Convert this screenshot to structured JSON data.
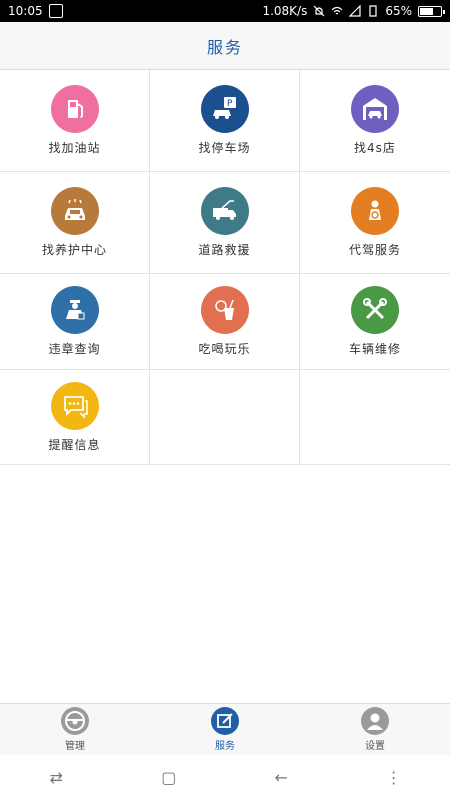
{
  "status": {
    "time": "10:05",
    "speed": "1.08K/s",
    "battery": "65%",
    "battery_level": 0.65
  },
  "header": {
    "title": "服务"
  },
  "services": [
    {
      "label": "找加油站",
      "icon": "gas-station-icon",
      "color": "#ee6fa0"
    },
    {
      "label": "找停车场",
      "icon": "parking-icon",
      "color": "#1c4f8f"
    },
    {
      "label": "找4s店",
      "icon": "car-garage-icon",
      "color": "#6f5fc0"
    },
    {
      "label": "找养护中心",
      "icon": "car-wash-icon",
      "color": "#b87a3a"
    },
    {
      "label": "道路救援",
      "icon": "tow-truck-icon",
      "color": "#3f7a87"
    },
    {
      "label": "代驾服务",
      "icon": "driver-icon",
      "color": "#e37f22"
    },
    {
      "label": "违章查询",
      "icon": "police-icon",
      "color": "#2f70a8"
    },
    {
      "label": "吃喝玩乐",
      "icon": "food-drink-icon",
      "color": "#e0704f"
    },
    {
      "label": "车辆维修",
      "icon": "tools-icon",
      "color": "#4a9a45"
    },
    {
      "label": "提醒信息",
      "icon": "message-icon",
      "color": "#f2b713"
    }
  ],
  "tabs": [
    {
      "label": "管理",
      "icon": "steering-wheel-icon"
    },
    {
      "label": "服务",
      "icon": "edit-icon"
    },
    {
      "label": "设置",
      "icon": "user-icon"
    }
  ]
}
